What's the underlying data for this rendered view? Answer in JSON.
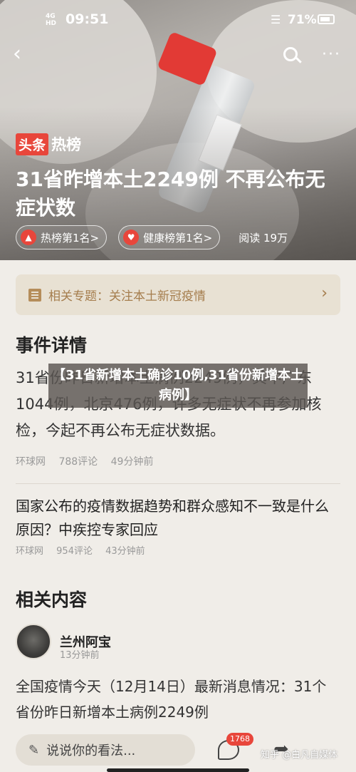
{
  "status_bar": {
    "network": "4G\nHD",
    "time": "09:51",
    "battery": "71%"
  },
  "hero": {
    "brand_part1": "头条",
    "brand_part2": "热榜",
    "title": "31省昨增本土2249例  不再公布无症状数",
    "chips": [
      {
        "label": "热榜第1名>"
      },
      {
        "label": "健康榜第1名>"
      }
    ],
    "reads": "阅读  19万"
  },
  "topic": {
    "label": "相关专题：关注本土新冠疫情"
  },
  "event_section": {
    "heading": "事件详情",
    "body": "31省份昨日新增本土病例2249例，其中广东1044例，北京476例，许多无症状不再参加核检，今起不再公布无症状数据。",
    "source": "环球网",
    "comments": "788评论",
    "time": "49分钟前"
  },
  "overlay_caption": "【31省新增本土确诊10例,31省份新增本土病例】",
  "article2": {
    "title": "国家公布的疫情数据趋势和群众感知不一致是什么原因？中疾控专家回应",
    "source": "环球网",
    "comments": "954评论",
    "time": "43分钟前"
  },
  "related": {
    "heading": "相关内容",
    "author": "兰州阿宝",
    "author_time": "13分钟前",
    "post": "全国疫情今天（12月14日）最新消息情况：31个省份昨日新增本土病例2249例"
  },
  "bottom_bar": {
    "comment_placeholder": "说说你的看法...",
    "comment_count": "1768",
    "watermark": "知乎 @白凡自媒体"
  },
  "colors": {
    "accent": "#e8463b",
    "topic_bg": "#e8e1d3",
    "topic_text": "#a57d4d",
    "page_bg": "#f0ede8"
  },
  "icons": [
    "back-icon",
    "search-icon",
    "more-icon",
    "fire-icon",
    "heart-icon",
    "topic-icon",
    "chevron-right-icon",
    "pen-icon",
    "comment-icon",
    "share-icon",
    "wifi-icon",
    "battery-icon"
  ]
}
